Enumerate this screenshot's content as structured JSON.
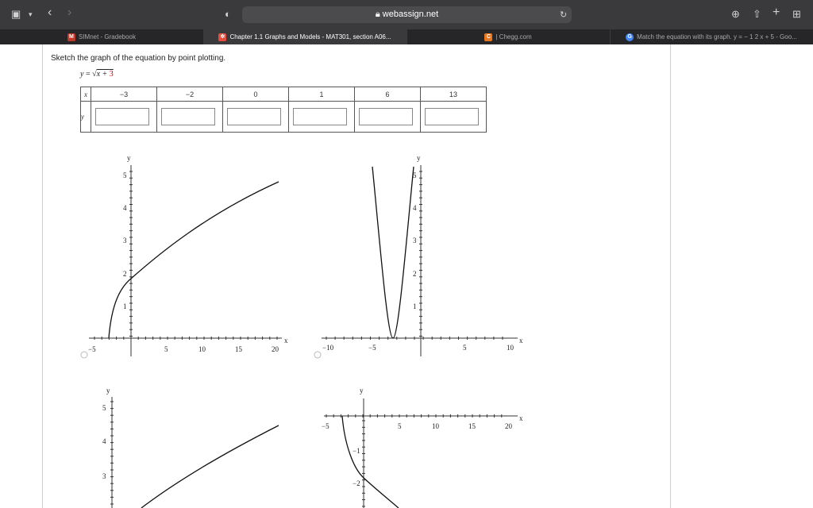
{
  "browser": {
    "url": "webassign.net",
    "tabs": [
      {
        "label": "SIMnet - Gradebook",
        "favicon": "M",
        "favicon_color": "#c0392b"
      },
      {
        "label": "Chapter 1.1 Graphs and Models - MAT301, section A06...",
        "favicon": "✲",
        "favicon_color": "#e74c3c"
      },
      {
        "label": "| Chegg.com",
        "favicon": "C",
        "favicon_color": "#e87722"
      },
      {
        "label": "Match the equation with its graph. y = − 1 2 x + 5 - Goo...",
        "favicon": "G",
        "favicon_color": "#4285f4"
      }
    ],
    "active_tab": 1
  },
  "question": {
    "prompt": "Sketch the graph of the equation by point plotting.",
    "equation_lhs": "y = √",
    "equation_x": "x + ",
    "equation_const": "3",
    "table": {
      "x_label": "x",
      "y_label": "y",
      "x_values": [
        "−3",
        "−2",
        "0",
        "1",
        "6",
        "13"
      ],
      "y_values": [
        "",
        "",
        "",
        "",
        "",
        ""
      ]
    }
  },
  "graphs": {
    "axis_x": "x",
    "axis_y": "y",
    "g1": {
      "x_ticks": [
        "−5",
        "5",
        "10",
        "15",
        "20"
      ],
      "y_ticks": [
        "1",
        "2",
        "3",
        "4",
        "5"
      ]
    },
    "g2": {
      "x_ticks": [
        "−10",
        "−5",
        "5",
        "10"
      ],
      "y_ticks": [
        "1",
        "2",
        "3",
        "4",
        "5"
      ]
    },
    "g3": {
      "y_ticks": [
        "3",
        "4",
        "5"
      ]
    },
    "g4": {
      "x_ticks": [
        "−5",
        "5",
        "10",
        "15",
        "20"
      ],
      "y_ticks": [
        "−1",
        "−2"
      ]
    }
  }
}
